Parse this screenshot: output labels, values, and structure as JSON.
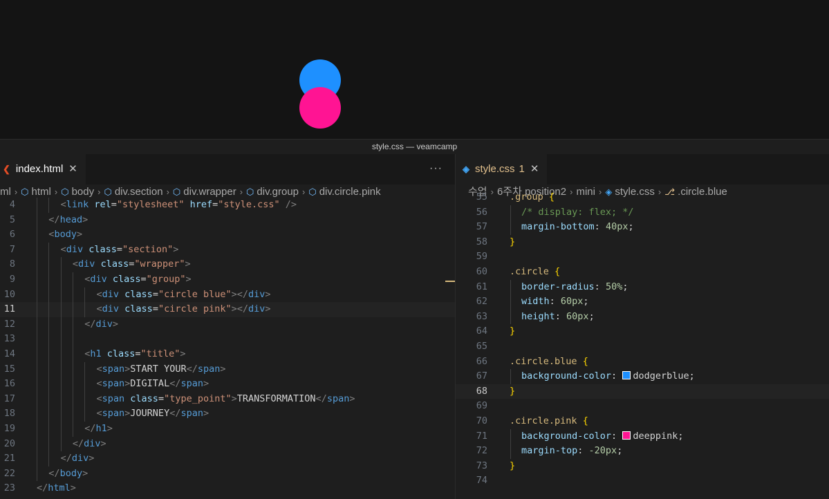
{
  "window": {
    "title": "style.css — veamcamp"
  },
  "colors": {
    "blue": "#1e90ff",
    "pink": "#ff1493"
  },
  "left": {
    "tab": {
      "label": "index.html",
      "icon": "html-file-icon"
    },
    "more": "···",
    "breadcrumb": [
      "ml",
      "html",
      "body",
      "div.section",
      "div.wrapper",
      "div.group",
      "div.circle.pink"
    ]
  },
  "right": {
    "tab": {
      "label": "style.css",
      "badge": "1",
      "icon": "css-file-icon"
    },
    "breadcrumb": [
      "수업",
      "6주차 position2",
      "mini",
      "style.css",
      ".circle.blue"
    ]
  }
}
